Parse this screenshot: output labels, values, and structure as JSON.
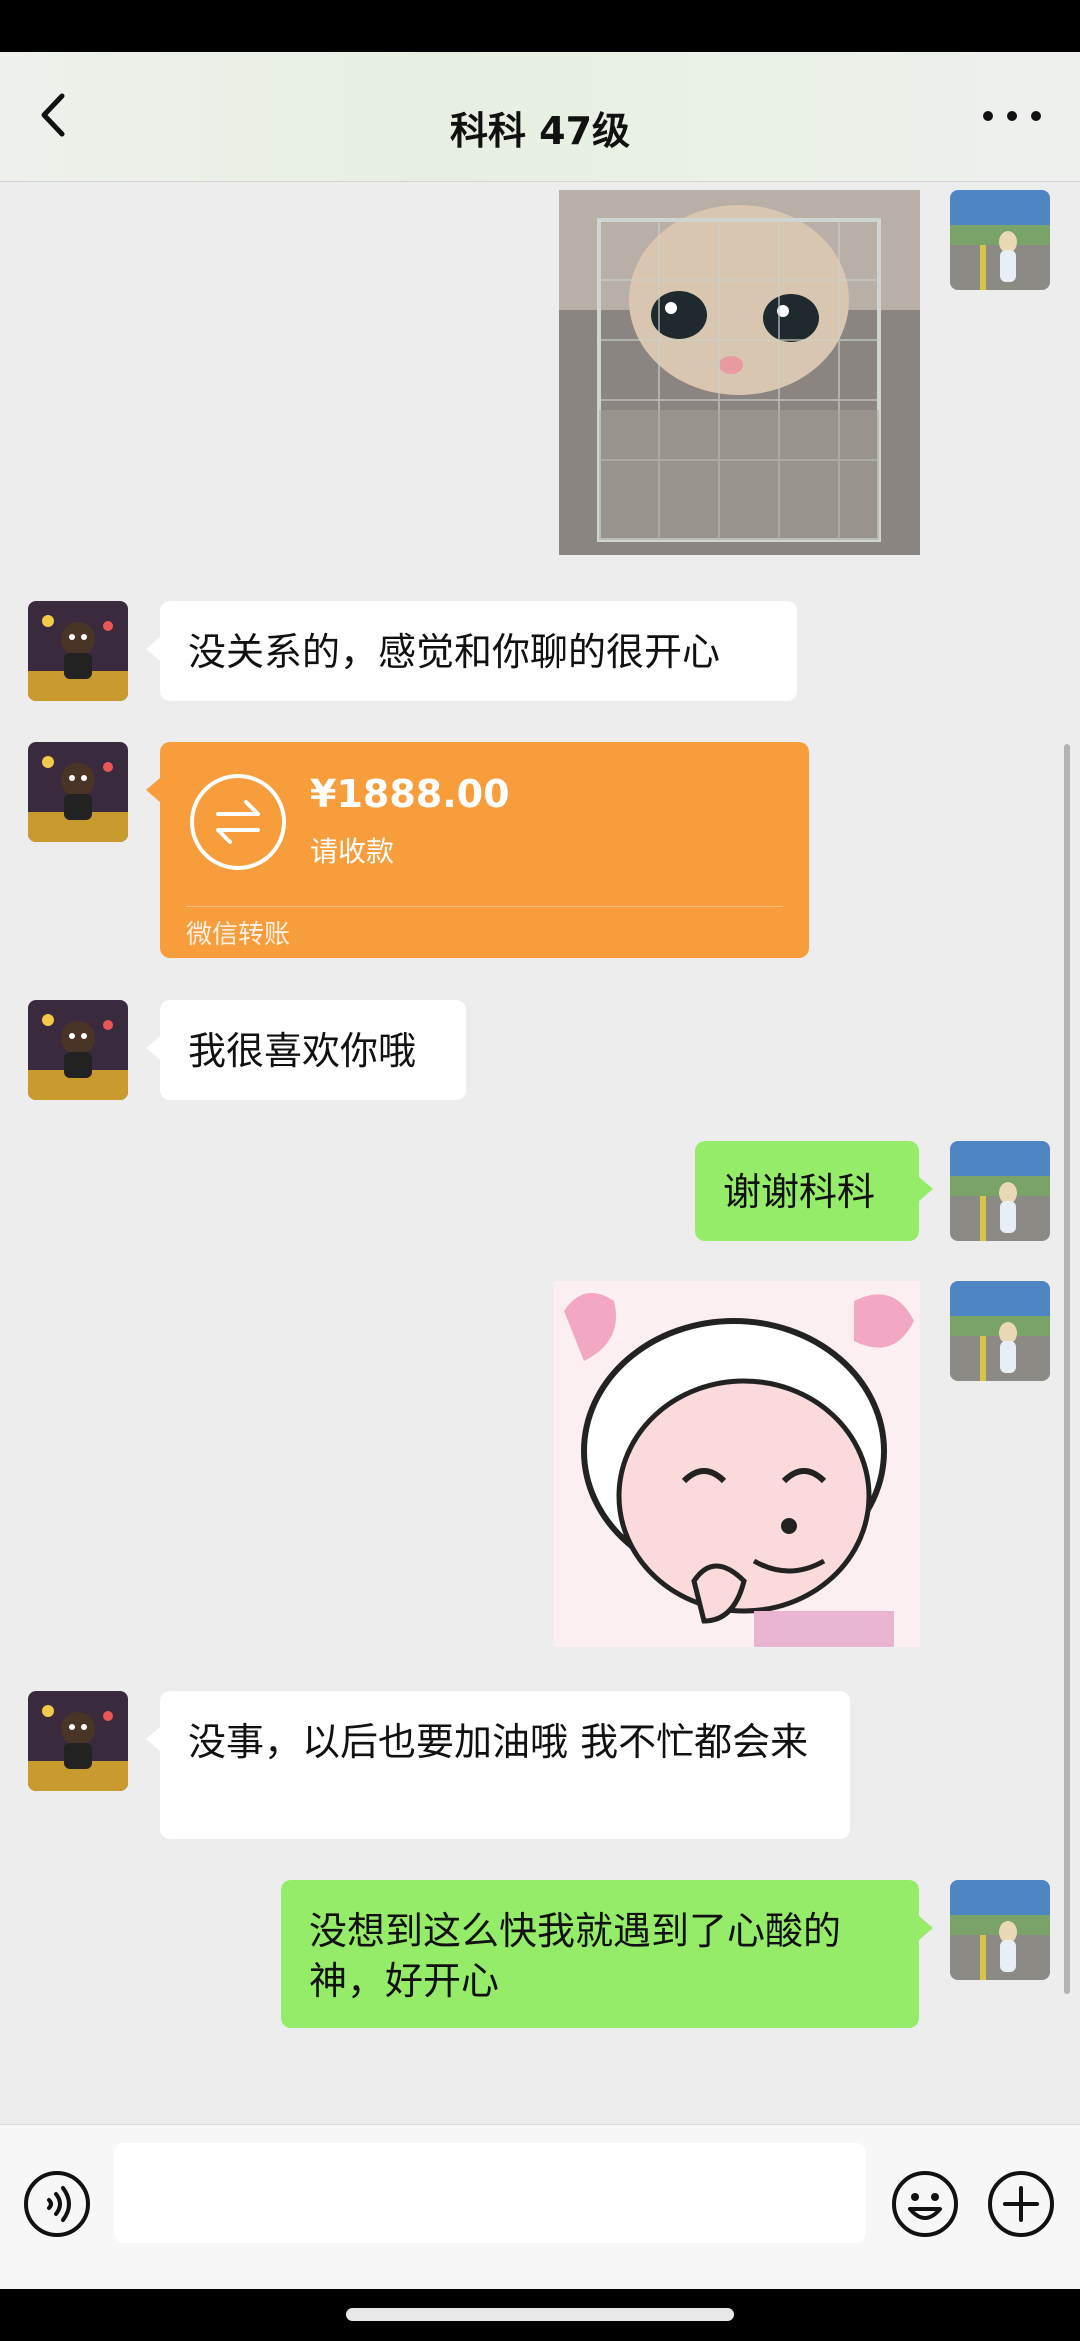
{
  "header": {
    "title": "科科 47级",
    "back_icon": "chevron-left-icon",
    "more_icon": "more-icon"
  },
  "messages": [
    {
      "side": "right",
      "type": "image",
      "description": "cat sticker"
    },
    {
      "side": "left",
      "type": "text",
      "text": "没关系的，感觉和你聊的很开心"
    },
    {
      "side": "left",
      "type": "transfer",
      "amount": "¥1888.00",
      "note": "请收款",
      "footer": "微信转账",
      "icon": "transfer-arrows-icon"
    },
    {
      "side": "left",
      "type": "text",
      "text": "我很喜欢你哦"
    },
    {
      "side": "right",
      "type": "text",
      "text": "谢谢科科"
    },
    {
      "side": "right",
      "type": "image",
      "description": "cartoon sticker"
    },
    {
      "side": "left",
      "type": "text",
      "text": "没事，以后也要加油哦 我不忙都会来"
    },
    {
      "side": "right",
      "type": "text",
      "text": "没想到这么快我就遇到了心酸的神，好开心"
    }
  ],
  "input_bar": {
    "value": "",
    "voice_icon": "voice-icon",
    "emoji_icon": "emoji-icon",
    "plus_icon": "plus-icon"
  },
  "colors": {
    "bg": "#ededed",
    "green_bubble": "#95ec69",
    "transfer": "#f89d3c"
  }
}
